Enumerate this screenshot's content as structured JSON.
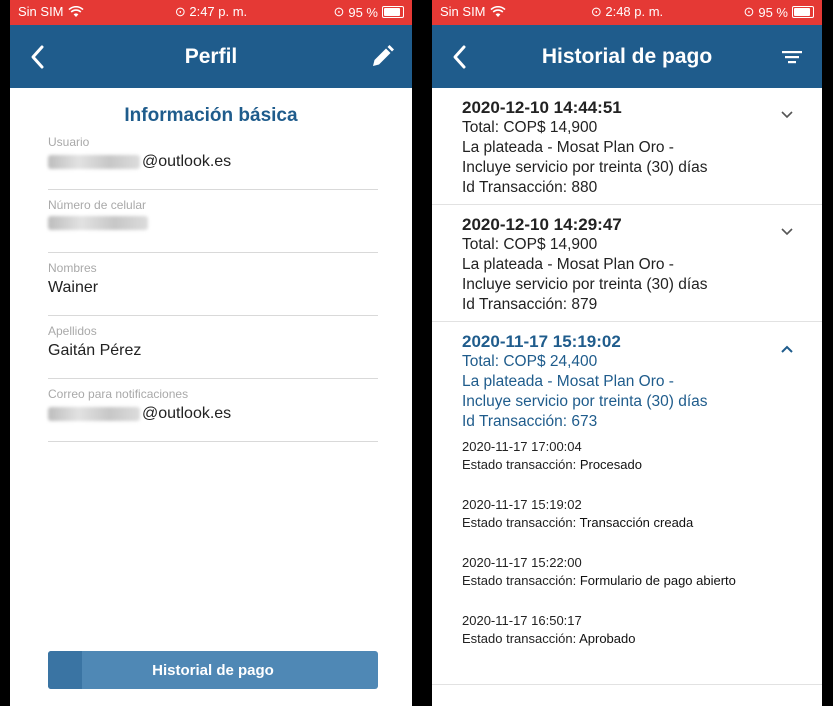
{
  "left": {
    "status": {
      "carrier": "Sin SIM",
      "time": "2:47 p. m.",
      "battery": "95 %",
      "battery_level": 0.95
    },
    "nav": {
      "title": "Perfil",
      "back_icon": "chevron-left-icon",
      "action_icon": "pencil-icon"
    },
    "section_title": "Información básica",
    "fields": [
      {
        "label": "Usuario",
        "value": "@outlook.es"
      },
      {
        "label": "Número de celular",
        "value": ""
      },
      {
        "label": "Nombres",
        "value": "Wainer"
      },
      {
        "label": "Apellidos",
        "value": "Gaitán Pérez"
      },
      {
        "label": "Correo para notificaciones",
        "value": "@outlook.es"
      }
    ],
    "button_label": "Historial de pago"
  },
  "right": {
    "status": {
      "carrier": "Sin SIM",
      "time": "2:48 p. m.",
      "battery": "95 %",
      "battery_level": 0.95
    },
    "nav": {
      "title": "Historial de pago",
      "back_icon": "chevron-left-icon",
      "action_icon": "filter-icon"
    },
    "entries": [
      {
        "datetime": "2020-12-10 14:44:51",
        "total": "Total: COP$ 14,900",
        "desc1": "La plateada - Mosat Plan Oro -",
        "desc2": "Incluye servicio por treinta (30) días",
        "txn": "Id Transacción: 880"
      },
      {
        "datetime": "2020-12-10 14:29:47",
        "total": "Total: COP$ 14,900",
        "desc1": "La plateada - Mosat Plan Oro -",
        "desc2": "Incluye servicio por treinta (30) días",
        "txn": "Id Transacción: 879"
      },
      {
        "datetime": "2020-11-17 15:19:02",
        "total": "Total: COP$ 24,400",
        "desc1": "La plateada - Mosat Plan Oro -",
        "desc2": "Incluye servicio por treinta (30) días",
        "txn": "Id Transacción: 673",
        "status_label": "Estado transacción:",
        "history": [
          {
            "time": "2020-11-17 17:00:04",
            "status": "Procesado"
          },
          {
            "time": "2020-11-17 15:19:02",
            "status": "Transacción creada"
          },
          {
            "time": "2020-11-17 15:22:00",
            "status": "Formulario de pago abierto"
          },
          {
            "time": "2020-11-17 16:50:17",
            "status": "Aprobado"
          }
        ]
      }
    ]
  },
  "colors": {
    "status_bar": "#e53935",
    "nav_bar": "#1f5c8c",
    "button": "#4f88b5",
    "accent_text": "#1f5c8c"
  }
}
